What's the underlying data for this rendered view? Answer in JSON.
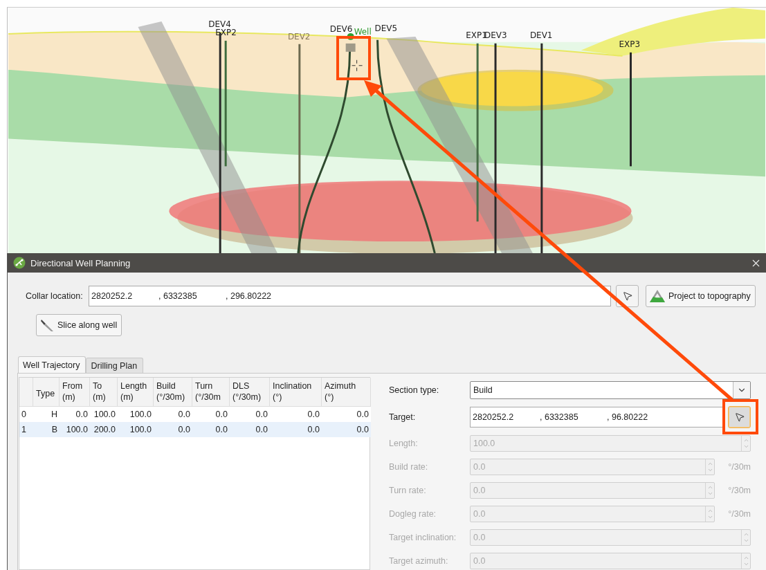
{
  "scene": {
    "wells": [
      {
        "label": "DEV4",
        "color": "#222222"
      },
      {
        "label": "EXP2",
        "color": "#222222"
      },
      {
        "label": "DEV2",
        "color": "#8a7b5c"
      },
      {
        "label": "DEV6",
        "color": "#222222"
      },
      {
        "label": "Well",
        "color": "#2e9a2e"
      },
      {
        "label": "DEV5",
        "color": "#222222"
      },
      {
        "label": "EXP1",
        "color": "#222222"
      },
      {
        "label": "DEV3",
        "color": "#222222"
      },
      {
        "label": "DEV1",
        "color": "#222222"
      },
      {
        "label": "EXP3",
        "color": "#222222"
      }
    ]
  },
  "dialog": {
    "title": "Directional Well Planning",
    "collar": {
      "label": "Collar location:",
      "values": [
        "2820252.2",
        ", 6332385",
        ", 296.80222"
      ]
    },
    "project_button": "Project to topography",
    "slice_button": "Slice along well",
    "tabs": [
      {
        "label": "Well Trajectory",
        "selected": true
      },
      {
        "label": "Drilling Plan",
        "selected": false
      }
    ],
    "table": {
      "columns": [
        {
          "label": "Type"
        },
        {
          "label": "From",
          "unit": "(m)"
        },
        {
          "label": "To",
          "unit": "(m)"
        },
        {
          "label": "Length",
          "unit": "(m)"
        },
        {
          "label": "Build",
          "unit": "(°/30m)"
        },
        {
          "label": "Turn",
          "unit": "(°/30m"
        },
        {
          "label": "DLS",
          "unit": "(°/30m)"
        },
        {
          "label": "Inclination",
          "unit": "(°)"
        },
        {
          "label": "Azimuth",
          "unit": "(°)"
        }
      ],
      "rows": [
        {
          "index": "0",
          "cells": [
            "H",
            "0.0",
            "100.0",
            "100.0",
            "0.0",
            "0.0",
            "0.0",
            "0.0",
            "0.0"
          ],
          "selected": false
        },
        {
          "index": "1",
          "cells": [
            "B",
            "100.0",
            "200.0",
            "100.0",
            "0.0",
            "0.0",
            "0.0",
            "0.0",
            "0.0"
          ],
          "selected": true
        }
      ]
    },
    "form": [
      {
        "kind": "dropdown",
        "label": "Section type:",
        "value": "Build",
        "disabled": false
      },
      {
        "kind": "coords",
        "label": "Target:",
        "values": [
          "2820252.2",
          ", 6332385",
          ", 96.80222"
        ],
        "disabled": false,
        "focused": true
      },
      {
        "kind": "spin",
        "label": "Length:",
        "value": "100.0",
        "disabled": true
      },
      {
        "kind": "spin",
        "label": "Build rate:",
        "value": "0.0",
        "unit": "°/30m",
        "disabled": true
      },
      {
        "kind": "spin",
        "label": "Turn rate:",
        "value": "0.0",
        "unit": "°/30m",
        "disabled": true
      },
      {
        "kind": "spin",
        "label": "Dogleg rate:",
        "value": "0.0",
        "unit": "°/30m",
        "disabled": true
      },
      {
        "kind": "spin",
        "label": "Target inclination:",
        "value": "0.0",
        "disabled": true
      },
      {
        "kind": "spin",
        "label": "Target azimuth:",
        "value": "0.0",
        "disabled": true
      }
    ]
  }
}
